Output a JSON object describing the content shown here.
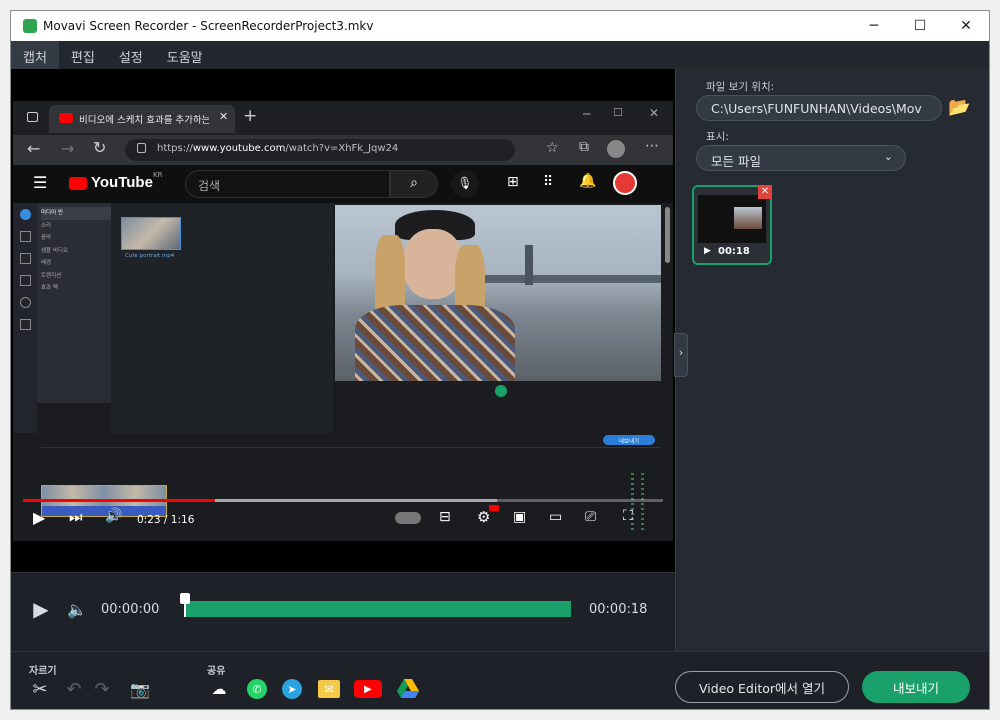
{
  "titlebar": {
    "title": "Movavi Screen Recorder - ScreenRecorderProject3.mkv",
    "minimize": "─",
    "maximize": "☐",
    "close": "✕"
  },
  "menu": [
    "캡처",
    "편집",
    "설정",
    "도움말"
  ],
  "browser": {
    "tab_title": "비디오에 스케치 효과를 추가하는",
    "url_prefix": "https://",
    "url_domain": "www.youtube.com",
    "url_path": "/watch?v=XhFk_Jqw24",
    "new_tab": "+"
  },
  "youtube": {
    "logo": "YouTube",
    "region": "KR",
    "search_placeholder": "검색",
    "time": "0:23 / 1:16",
    "progress": 0.3,
    "inner_panel_items": [
      "미디어 빈",
      "소리",
      "음악",
      "샘플 비디오",
      "배경",
      "트랜지션",
      "효과 팩"
    ],
    "inner_clip_label": "Cute portrait.mp4",
    "inner_export": "내보내기"
  },
  "player": {
    "current": "00:00:00",
    "duration": "00:00:18",
    "progress": 0.0
  },
  "right": {
    "location_label": "파일 보기 위치:",
    "location_value": "C:\\Users\\FUNFUNHAN\\Videos\\Mov",
    "show_label": "표시:",
    "show_value": "모든 파일",
    "thumb_duration": "00:18"
  },
  "bottom": {
    "trim_label": "자르기",
    "share_label": "공유",
    "open_editor": "Video Editor에서 열기",
    "export": "내보내기"
  },
  "colors": {
    "accent": "#1aa06a",
    "youtube_red": "#ff0000",
    "dark_bg": "#1e2228"
  }
}
